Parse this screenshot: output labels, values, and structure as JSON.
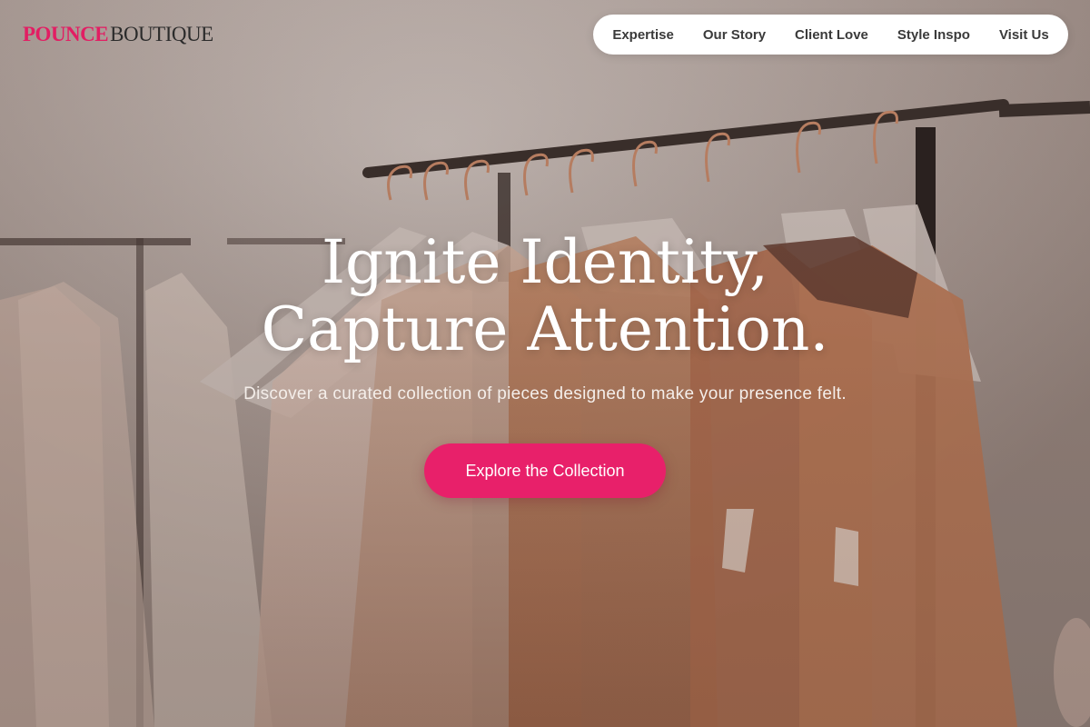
{
  "logo": {
    "primary": "POUNCE",
    "secondary": "BOUTIQUE"
  },
  "nav": {
    "items": [
      {
        "label": "Expertise"
      },
      {
        "label": "Our Story"
      },
      {
        "label": "Client Love"
      },
      {
        "label": "Style Inspo"
      },
      {
        "label": "Visit Us"
      }
    ]
  },
  "hero": {
    "headline_line1": "Ignite Identity,",
    "headline_line2": "Capture Attention.",
    "subheadline": "Discover a curated collection of pieces designed to make your presence felt.",
    "cta_label": "Explore the Collection"
  },
  "colors": {
    "brand_accent": "#e21e63",
    "cta_background": "#e8206a",
    "nav_background": "#ffffff"
  }
}
